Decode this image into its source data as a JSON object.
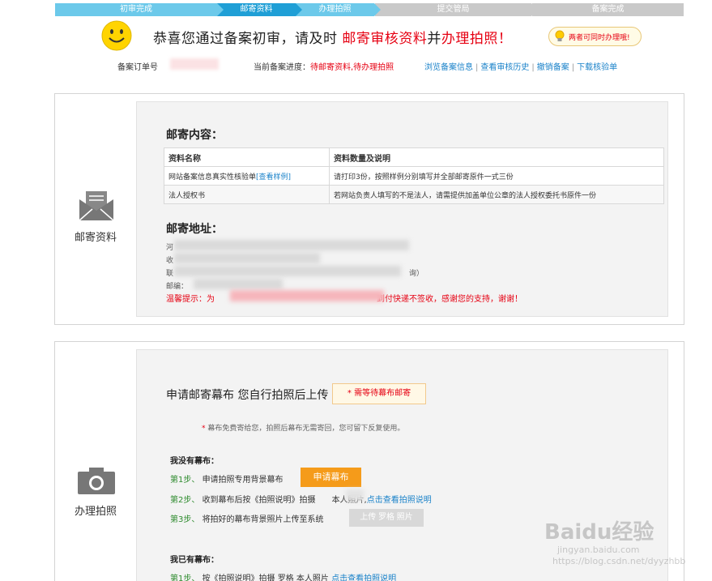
{
  "steps": [
    {
      "label": "初审完成",
      "state": "done"
    },
    {
      "label": "邮寄资料",
      "state": "cur"
    },
    {
      "label": "办理拍照",
      "state": "done"
    },
    {
      "label": "提交管局",
      "state": "todo"
    },
    {
      "label": "备案完成",
      "state": "todo"
    }
  ],
  "header": {
    "congrats_1": "恭喜您通过备案初审，请及时",
    "congrats_red1": "邮寄审核资料",
    "congrats_2": "并",
    "congrats_red2": "办理拍照！",
    "tip": "两者可同时办理哦!"
  },
  "info": {
    "order_label": "备案订单号",
    "progress_label": "当前备案进度：",
    "progress_value": "待邮寄资料,待办理拍照",
    "links": [
      "浏览备案信息",
      "查看审核历史",
      "撤销备案",
      "下载核验单"
    ]
  },
  "mail": {
    "side_label": "邮寄资料",
    "content_title": "邮寄内容：",
    "table_headers": [
      "资料名称",
      "资料数量及说明"
    ],
    "rows": [
      {
        "name": "网站备案信息真实性核验单",
        "link": "[查看样例]",
        "desc": "请打印3份，按照样例分别填写并全部邮寄原件一式三份"
      },
      {
        "name": "法人授权书",
        "link": "",
        "desc": "若网站负责人填写的不是法人，请需提供加盖单位公章的法人授权委托书原件一份"
      }
    ],
    "address_title": "邮寄地址：",
    "addr_lines": [
      "河",
      "收",
      "联",
      "邮编："
    ],
    "addr_suffix": "询）",
    "warm_prefix": "温馨提示：为",
    "warm_suffix": "到付快递不签收，感谢您的支持，谢谢！"
  },
  "photo": {
    "side_label": "办理拍照",
    "apply_title": "申请邮寄幕布 您自行拍照后上传",
    "wait_badge": "* 需等待幕布邮寄",
    "note_star": "*",
    "note": "幕布免费寄给您，拍照后幕布无需寄回，您可留下反复使用。",
    "no_curtain_title": "我没有幕布：",
    "step1_label": "第1步、",
    "step1_text": "申请拍照专用背景幕布",
    "apply_btn": "申请幕布",
    "step2_label": "第2步、",
    "step2_text": "收到幕布后按《拍照说明》拍摄",
    "step2_mid": "本人照片,",
    "step2_link": "点击查看拍照说明",
    "step3_label": "第3步、",
    "step3_text": "将拍好的幕布背景照片上传至系统",
    "upload_btn": "上传 罗格 照片",
    "have_curtain_title": "我已有幕布：",
    "step1b_label": "第1步、",
    "step1b_text": "按《拍照说明》拍摄 罗格 本人照片",
    "step1b_link": "点击查看拍照说明"
  },
  "watermark": {
    "logo": "Baidu经验",
    "url": "jingyan.baidu.com",
    "blog": "https://blog.csdn.net/dyyzhbb"
  }
}
